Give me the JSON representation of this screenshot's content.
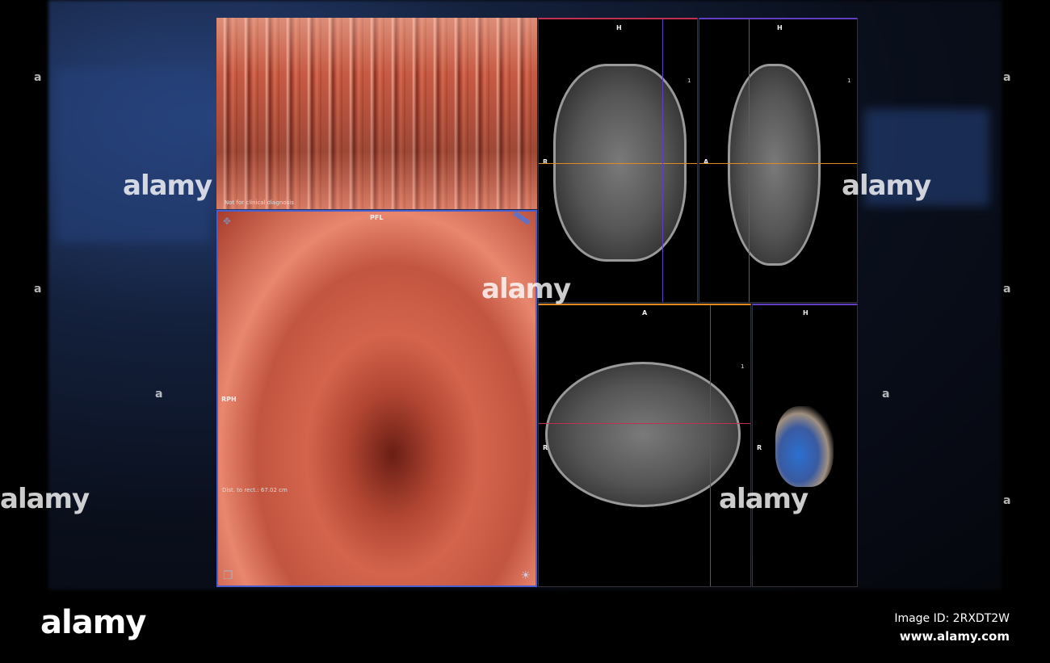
{
  "flythrough": {
    "disclaimer": "Not for clinical diagnosis"
  },
  "endoscopic": {
    "top_label": "PFL",
    "left_label": "RPH",
    "distance": "Dist. to rect.: 67.02 cm"
  },
  "coronal": {
    "top_label": "H",
    "left_label": "R",
    "slice": "1"
  },
  "sagittal": {
    "top_label": "H",
    "left_label": "A",
    "slice": "1"
  },
  "axial": {
    "top_label": "A",
    "left_label": "R",
    "slice": "1"
  },
  "volume3d": {
    "top_label": "H",
    "left_label": "R"
  },
  "watermark": {
    "text": "alamy",
    "marker": "a"
  },
  "footer": {
    "logo": "alamy",
    "image_id": "Image ID: 2RXDT2W",
    "url": "www.alamy.com"
  },
  "colors": {
    "endo_border": "#4a5fd0",
    "crosshair_h": "#e08a20",
    "crosshair_v": "#6040c0",
    "tissue": "#d4644c"
  }
}
